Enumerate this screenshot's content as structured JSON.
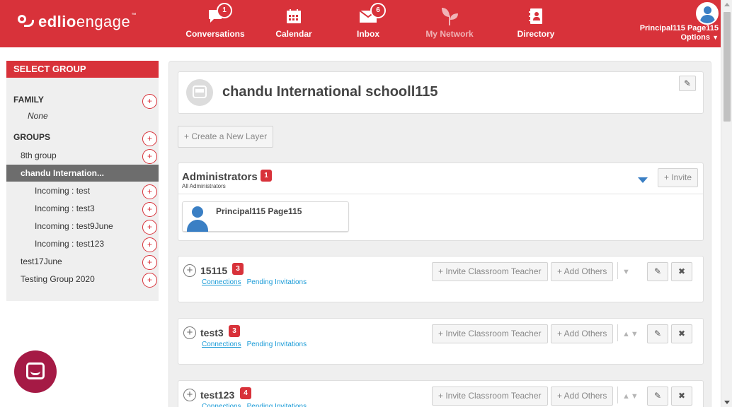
{
  "brand": {
    "name_bold": "edlio",
    "name_light": "engage",
    "tm": "™"
  },
  "nav": {
    "items": [
      {
        "label": "Conversations",
        "badge": "1"
      },
      {
        "label": "Calendar"
      },
      {
        "label": "Inbox",
        "badge": "6"
      },
      {
        "label": "My Network"
      },
      {
        "label": "Directory"
      }
    ]
  },
  "user": {
    "name": "Principal115 Page115",
    "options_label": "Options"
  },
  "sidebar": {
    "title": "SELECT GROUP",
    "family_heading": "FAMILY",
    "family_none": "None",
    "groups_heading": "GROUPS",
    "items": [
      "8th group",
      "chandu Internation...",
      "Incoming : test",
      "Incoming : test3",
      "Incoming : test9June",
      "Incoming : test123",
      "test17June",
      "Testing Group 2020"
    ],
    "plus": "+"
  },
  "main": {
    "school_name": "chandu International schooll115",
    "create_layer_label": "+ Create a New Layer",
    "administrators": {
      "title": "Administrators",
      "count": "1",
      "subtitle": "All Administrators",
      "invite_label": "+ Invite",
      "member_name": "Principal115 Page115"
    },
    "layers": [
      {
        "name": "15115",
        "count": "3"
      },
      {
        "name": "test3",
        "count": "3"
      },
      {
        "name": "test123",
        "count": "4"
      }
    ],
    "invite_teacher_label": "+ Invite Classroom Teacher",
    "add_others_label": "+ Add Others",
    "connections_label": "Connections",
    "pending_label": "Pending Invitations",
    "expand_symbol": "+",
    "close_symbol": "✖",
    "edit_symbol": "✎",
    "arrow_up": "▲",
    "arrow_down": "▼"
  },
  "colors": {
    "brand_red": "#d8323a",
    "link_blue": "#1a9bd7",
    "avatar_blue": "#3a7fc4",
    "chat_maroon": "#a51a45"
  }
}
